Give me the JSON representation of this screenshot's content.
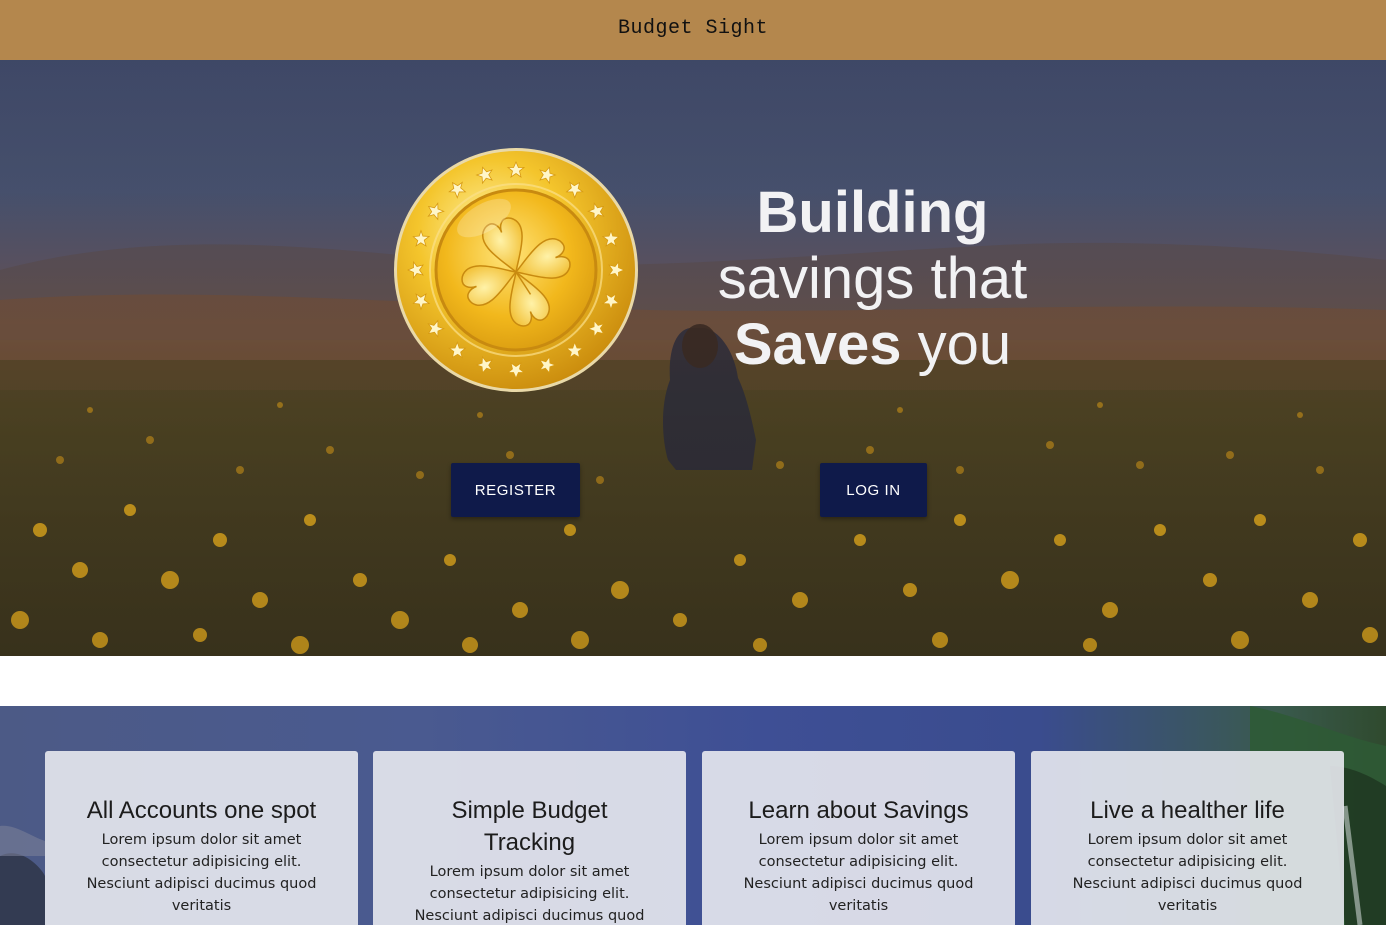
{
  "header": {
    "brand": "Budget Sight"
  },
  "hero": {
    "headline_line1": "Building",
    "headline_line2": "savings that",
    "headline_line3_bold": "Saves",
    "headline_line3_thin": "you",
    "register_label": "REGISTER",
    "login_label": "LOG IN"
  },
  "features": [
    {
      "title": "All Accounts one spot",
      "text": "Lorem ipsum dolor sit amet consectetur adipisicing elit. Nesciunt adipisci ducimus quod veritatis"
    },
    {
      "title": "Simple Budget Tracking",
      "text": "Lorem ipsum dolor sit amet consectetur adipisicing elit. Nesciunt adipisci ducimus quod veritatis"
    },
    {
      "title": "Learn about Savings",
      "text": "Lorem ipsum dolor sit amet consectetur adipisicing elit. Nesciunt adipisci ducimus quod veritatis"
    },
    {
      "title": "Live a healther life",
      "text": "Lorem ipsum dolor sit amet consectetur adipisicing elit. Nesciunt adipisci ducimus quod veritatis"
    }
  ],
  "colors": {
    "topbar": "#b4874d",
    "button": "#0f1a4a",
    "headline": "#f2f2f4",
    "coin_gold": "#f2c230"
  }
}
